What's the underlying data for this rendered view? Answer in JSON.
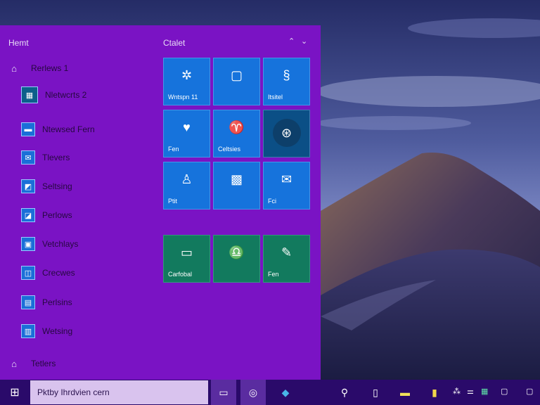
{
  "start_menu": {
    "header": "Hemt",
    "group_title": "Ctalet",
    "group_controls": [
      "⌃",
      "⌄"
    ],
    "apps": [
      {
        "label": "Rerlews 1",
        "icon": "home-icon",
        "glyph": "⌂",
        "style": "plain"
      },
      {
        "label": "Nletwcrts 2",
        "icon": "app-icon",
        "glyph": "▦",
        "style": "tile"
      },
      {
        "label": "Ntewsed Fern",
        "icon": "app-icon",
        "glyph": "▬",
        "style": "tile"
      },
      {
        "label": "Tlevers",
        "icon": "app-icon",
        "glyph": "✉",
        "style": "tile"
      },
      {
        "label": "Seltsing",
        "icon": "app-icon",
        "glyph": "◩",
        "style": "tile"
      },
      {
        "label": "Perlows",
        "icon": "app-icon",
        "glyph": "◪",
        "style": "tile"
      },
      {
        "label": "Vetchlays",
        "icon": "app-icon",
        "glyph": "▣",
        "style": "tile"
      },
      {
        "label": "Crecwes",
        "icon": "app-icon",
        "glyph": "◫",
        "style": "tile"
      },
      {
        "label": "Perlsins",
        "icon": "app-icon",
        "glyph": "▤",
        "style": "tile"
      },
      {
        "label": "Wetsing",
        "icon": "app-icon",
        "glyph": "▥",
        "style": "tile"
      },
      {
        "label": "Tetlers",
        "icon": "user-icon",
        "glyph": "⌂",
        "style": "plain"
      }
    ],
    "tiles": [
      {
        "label": "Wntspn 11",
        "icon": "gear-icon",
        "glyph": "✲",
        "color": "blue"
      },
      {
        "label": "",
        "icon": "document-icon",
        "glyph": "▢",
        "color": "blue"
      },
      {
        "label": "Itsitel",
        "icon": "bookmark-icon",
        "glyph": "§",
        "color": "blue"
      },
      {
        "label": "Fen",
        "icon": "shield-icon",
        "glyph": "♥",
        "color": "blue"
      },
      {
        "label": "Celtsies",
        "icon": "ticket-icon",
        "glyph": "♈",
        "color": "blue"
      },
      {
        "label": "",
        "icon": "globe-icon",
        "glyph": "⊛",
        "color": "dark"
      },
      {
        "label": "Ptit",
        "icon": "store-icon",
        "glyph": "♙",
        "color": "blue"
      },
      {
        "label": "",
        "icon": "calendar-icon",
        "glyph": "▩",
        "color": "blue"
      },
      {
        "label": "Fci",
        "icon": "mail-icon",
        "glyph": "✉",
        "color": "blue"
      },
      {
        "label": "Carfobal",
        "icon": "folder-icon",
        "glyph": "▭",
        "color": "green"
      },
      {
        "label": "",
        "icon": "headset-icon",
        "glyph": "♎",
        "color": "green"
      },
      {
        "label": "Fen",
        "icon": "pencil-icon",
        "glyph": "✎",
        "color": "green"
      }
    ]
  },
  "taskbar": {
    "start_glyph": "⊞",
    "search_text": "Pktby Ihrdvien cern",
    "buttons": [
      {
        "name": "task-view",
        "glyph": "▭"
      },
      {
        "name": "cortana",
        "glyph": "◎"
      },
      {
        "name": "app-pinned",
        "glyph": "◆"
      },
      {
        "name": "search",
        "glyph": "⚲"
      },
      {
        "name": "file-explorer",
        "glyph": "▯"
      },
      {
        "name": "app-yellow",
        "glyph": "▬"
      },
      {
        "name": "app-folder",
        "glyph": "▮"
      }
    ],
    "tray": [
      "⁂",
      "⚌",
      "▦",
      "▢"
    ]
  },
  "colors": {
    "start_bg": "#7a13c4",
    "tile_blue": "#1673dc",
    "tile_green": "#127a5e",
    "taskbar_bg": "#2a0a6a"
  }
}
